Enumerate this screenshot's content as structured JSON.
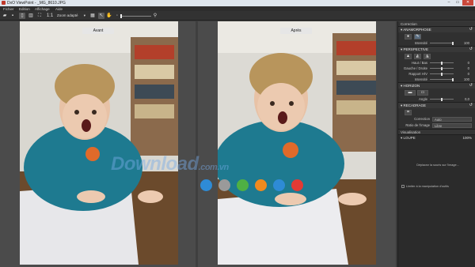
{
  "window": {
    "title": "DxO ViewPoint - _MG_8610.JPG",
    "controls": [
      "–",
      "▭",
      "✕"
    ]
  },
  "menu": [
    "Fichier",
    "Edition",
    "Affichage",
    "Aide"
  ],
  "toolbar": {
    "zoom_value": "Zoom adapté",
    "one_to_one": "1:1"
  },
  "viewer": {
    "before_label": "Avant",
    "after_label": "Après"
  },
  "watermark": {
    "text": "Download",
    "suffix": ".com.vn"
  },
  "dot_colors": [
    "#2e8bd6",
    "#9a9a9a",
    "#4fb043",
    "#f08a1e",
    "#2e8bd6",
    "#e23a34"
  ],
  "panel": {
    "header": "Correction",
    "anamorphose": {
      "title": "ANAMORPHOSE",
      "row_label": "Intensité",
      "row_value": "100"
    },
    "perspective": {
      "title": "PERSPECTIVE",
      "rows": [
        {
          "label": "Haut / Bas",
          "value": "0"
        },
        {
          "label": "Gauche / Droite",
          "value": "0"
        },
        {
          "label": "Rapport H/V",
          "value": "0"
        },
        {
          "label": "Intensité",
          "value": "100"
        }
      ]
    },
    "horizon": {
      "title": "HORIZON",
      "row_label": "Angle",
      "row_value": "0,0"
    },
    "recadrage": {
      "title": "RECADRAGE",
      "correction_label": "Correction",
      "correction_value": "Auto",
      "ratio_label": "Ratio de l'image",
      "ratio_value": "Libre"
    },
    "visualisation": {
      "header": "Visualisation",
      "loupe_title": "LOUPE",
      "zoom": "100%",
      "message": "Déplacez la souris sur l'image...",
      "checkbox": "Limiter à la manipulation d'outils"
    }
  }
}
